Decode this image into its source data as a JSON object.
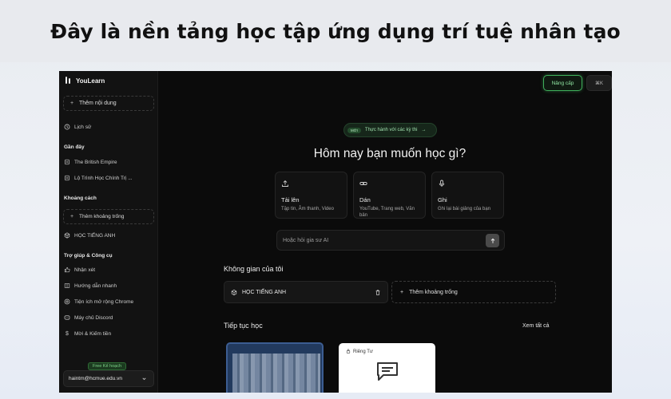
{
  "banner": {
    "title": "Đây là nền tảng học tập ứng dụng trí tuệ nhân tạo"
  },
  "app": {
    "name": "YouLearn"
  },
  "sidebar": {
    "add_content": "Thêm nội dung",
    "history": "Lịch sử",
    "recent_heading": "Gần đây",
    "recent_items": [
      "The British Empire",
      "Lộ Trình Học Chính Trị ..."
    ],
    "spaces_heading": "Khoảng cách",
    "add_space": "Thêm khoảng trống",
    "space_item": "HỌC TIẾNG ANH",
    "help_heading": "Trợ giúp & Công cụ",
    "help_items": [
      "Nhận xét",
      "Hướng dẫn nhanh",
      "Tiện ích mở rộng Chrome",
      "Máy chủ Discord",
      "Mời & Kiếm tiền"
    ],
    "plan_tag": "Free Kế hoạch",
    "account_email": "haintm@hcmue.edu.vn"
  },
  "topbar": {
    "upgrade": "Nâng cấp",
    "shortcut": "⌘K"
  },
  "main": {
    "new_badge": "MỚI",
    "new_text": "Thực hành với các kỳ thi",
    "hero": "Hôm nay bạn muốn học gì?",
    "cards": [
      {
        "icon": "upload-icon",
        "title": "Tải lên",
        "desc": "Tập tin, Âm thanh, Video"
      },
      {
        "icon": "link-icon",
        "title": "Dán",
        "desc": "YouTube, Trang web, Văn bản"
      },
      {
        "icon": "mic-icon",
        "title": "Ghi",
        "desc": "Ghi lại bài giảng của bạn"
      }
    ],
    "ask_placeholder": "Hoặc hỏi gia sư AI",
    "my_space_title": "Không gian của tôi",
    "space_card": "HỌC TIẾNG ANH",
    "add_space": "Thêm khoảng trống",
    "continue_title": "Tiếp tục học",
    "see_all": "Xem tất cả",
    "private_label": "Riêng Tư"
  },
  "colors": {
    "accent_green": "#3fae5a",
    "background": "#0b0b0b"
  }
}
